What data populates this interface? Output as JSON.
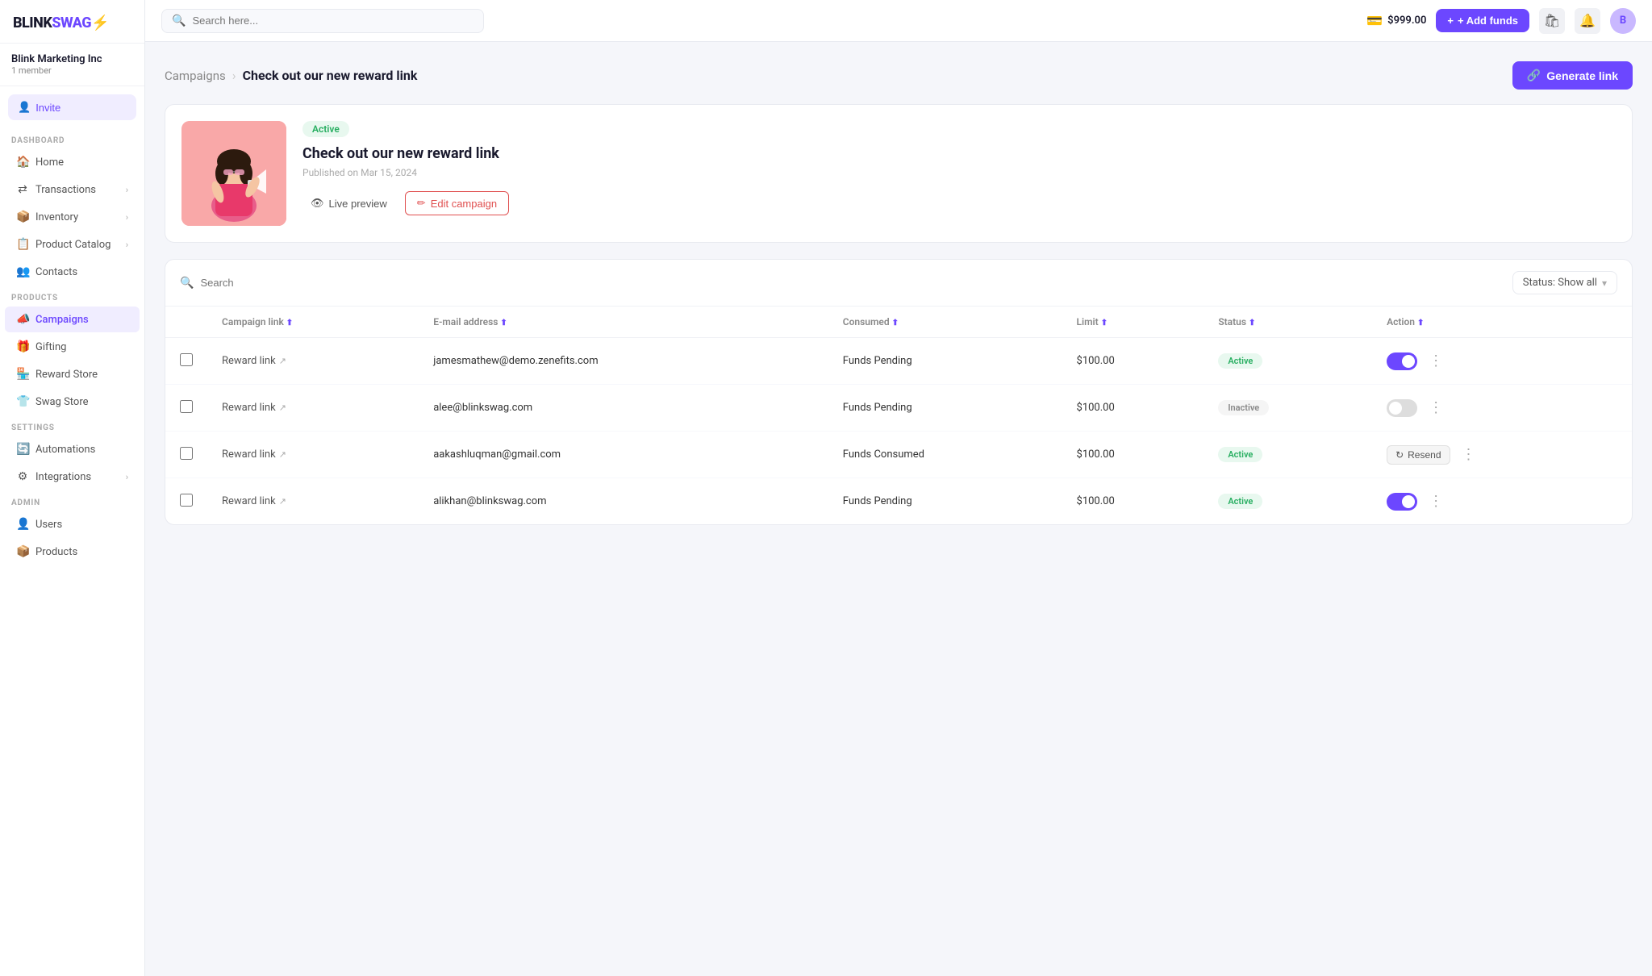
{
  "logo": {
    "text": "BLINK",
    "highlight": "SWAG",
    "icon": "⚡"
  },
  "org": {
    "name": "Blink Marketing Inc",
    "member_count": "1 member"
  },
  "invite_btn": "Invite",
  "topbar": {
    "search_placeholder": "Search here...",
    "balance": "$999.00",
    "add_funds_label": "+ Add funds"
  },
  "sidebar": {
    "sections": [
      {
        "label": "DASHBOARD",
        "items": [
          {
            "id": "home",
            "label": "Home",
            "icon": "🏠",
            "has_chevron": false
          },
          {
            "id": "transactions",
            "label": "Transactions",
            "icon": "↔",
            "has_chevron": true
          },
          {
            "id": "inventory",
            "label": "Inventory",
            "icon": "📦",
            "has_chevron": true
          },
          {
            "id": "product-catalog",
            "label": "Product Catalog",
            "icon": "📋",
            "has_chevron": true
          },
          {
            "id": "contacts",
            "label": "Contacts",
            "icon": "👥",
            "has_chevron": false
          }
        ]
      },
      {
        "label": "PRODUCTS",
        "items": [
          {
            "id": "campaigns",
            "label": "Campaigns",
            "icon": "📣",
            "has_chevron": false,
            "active": true
          },
          {
            "id": "gifting",
            "label": "Gifting",
            "icon": "🎁",
            "has_chevron": false
          },
          {
            "id": "reward-store",
            "label": "Reward Store",
            "icon": "🏪",
            "has_chevron": false
          },
          {
            "id": "swag-store",
            "label": "Swag Store",
            "icon": "👕",
            "has_chevron": false
          }
        ]
      },
      {
        "label": "SETTINGS",
        "items": [
          {
            "id": "automations",
            "label": "Automations",
            "icon": "🔄",
            "has_chevron": false
          },
          {
            "id": "integrations",
            "label": "Integrations",
            "icon": "⚙",
            "has_chevron": true
          }
        ]
      },
      {
        "label": "ADMIN",
        "items": [
          {
            "id": "users",
            "label": "Users",
            "icon": "👤",
            "has_chevron": false
          },
          {
            "id": "products",
            "label": "Products",
            "icon": "📦",
            "has_chevron": false
          }
        ]
      }
    ]
  },
  "breadcrumb": {
    "parent": "Campaigns",
    "current": "Check out our new reward link"
  },
  "generate_link_btn": "Generate link",
  "campaign": {
    "status": "Active",
    "title": "Check out our new reward link",
    "published": "Published on Mar 15, 2024",
    "live_preview_label": "Live preview",
    "edit_campaign_label": "Edit campaign"
  },
  "table": {
    "search_placeholder": "Search",
    "status_filter_label": "Status: Show all",
    "columns": [
      {
        "id": "checkbox",
        "label": ""
      },
      {
        "id": "campaign_link",
        "label": "Campaign link"
      },
      {
        "id": "email",
        "label": "E-mail address"
      },
      {
        "id": "consumed",
        "label": "Consumed"
      },
      {
        "id": "limit",
        "label": "Limit"
      },
      {
        "id": "status",
        "label": "Status"
      },
      {
        "id": "action",
        "label": "Action"
      }
    ],
    "rows": [
      {
        "id": 1,
        "link": "Reward link",
        "email": "jamesmathew@demo.zenefits.com",
        "consumed": "Funds Pending",
        "limit": "$100.00",
        "status": "Active",
        "toggle": true,
        "action_type": "toggle"
      },
      {
        "id": 2,
        "link": "Reward link",
        "email": "alee@blinkswag.com",
        "consumed": "Funds Pending",
        "limit": "$100.00",
        "status": "Inactive",
        "toggle": false,
        "action_type": "toggle"
      },
      {
        "id": 3,
        "link": "Reward link",
        "email": "aakashluqman@gmail.com",
        "consumed": "Funds Consumed",
        "limit": "$100.00",
        "status": "Active",
        "toggle": false,
        "action_type": "resend",
        "resend_label": "Resend"
      },
      {
        "id": 4,
        "link": "Reward link",
        "email": "alikhan@blinkswag.com",
        "consumed": "Funds Pending",
        "limit": "$100.00",
        "status": "Active",
        "toggle": true,
        "action_type": "toggle"
      }
    ]
  }
}
